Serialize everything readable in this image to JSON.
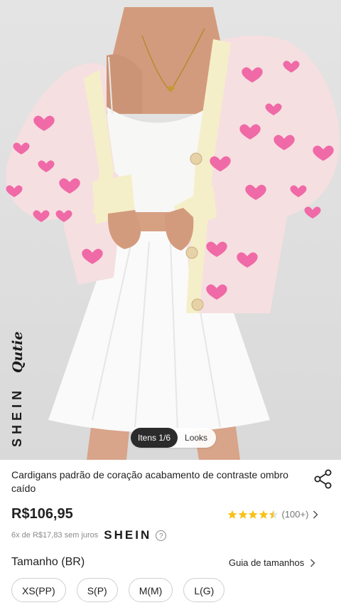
{
  "gallery": {
    "watermark": {
      "brand": "SHEIN",
      "sub": "Qutie"
    },
    "pager": {
      "index_label": "Itens 1/6",
      "looks_label": "Looks"
    }
  },
  "product": {
    "title": "Cardigans padrão de coração acabamento de contraste ombro caído",
    "price": "R$106,95",
    "rating": {
      "stars": 4.5,
      "count_label": "(100+)"
    },
    "installments": {
      "text": "6x de R$17,83 sem juros",
      "brand": "SHEIN",
      "help": "?"
    }
  },
  "size_section": {
    "label": "Tamanho (BR)",
    "guide_label": "Guia de tamanhos",
    "options": [
      "XS(PP)",
      "S(P)",
      "M(M)",
      "L(G)"
    ]
  },
  "colors": {
    "star": "#f9c21a",
    "cardigan": "#f6dfe1",
    "heart": "#ef6aa6",
    "trim": "#f5efc9"
  }
}
